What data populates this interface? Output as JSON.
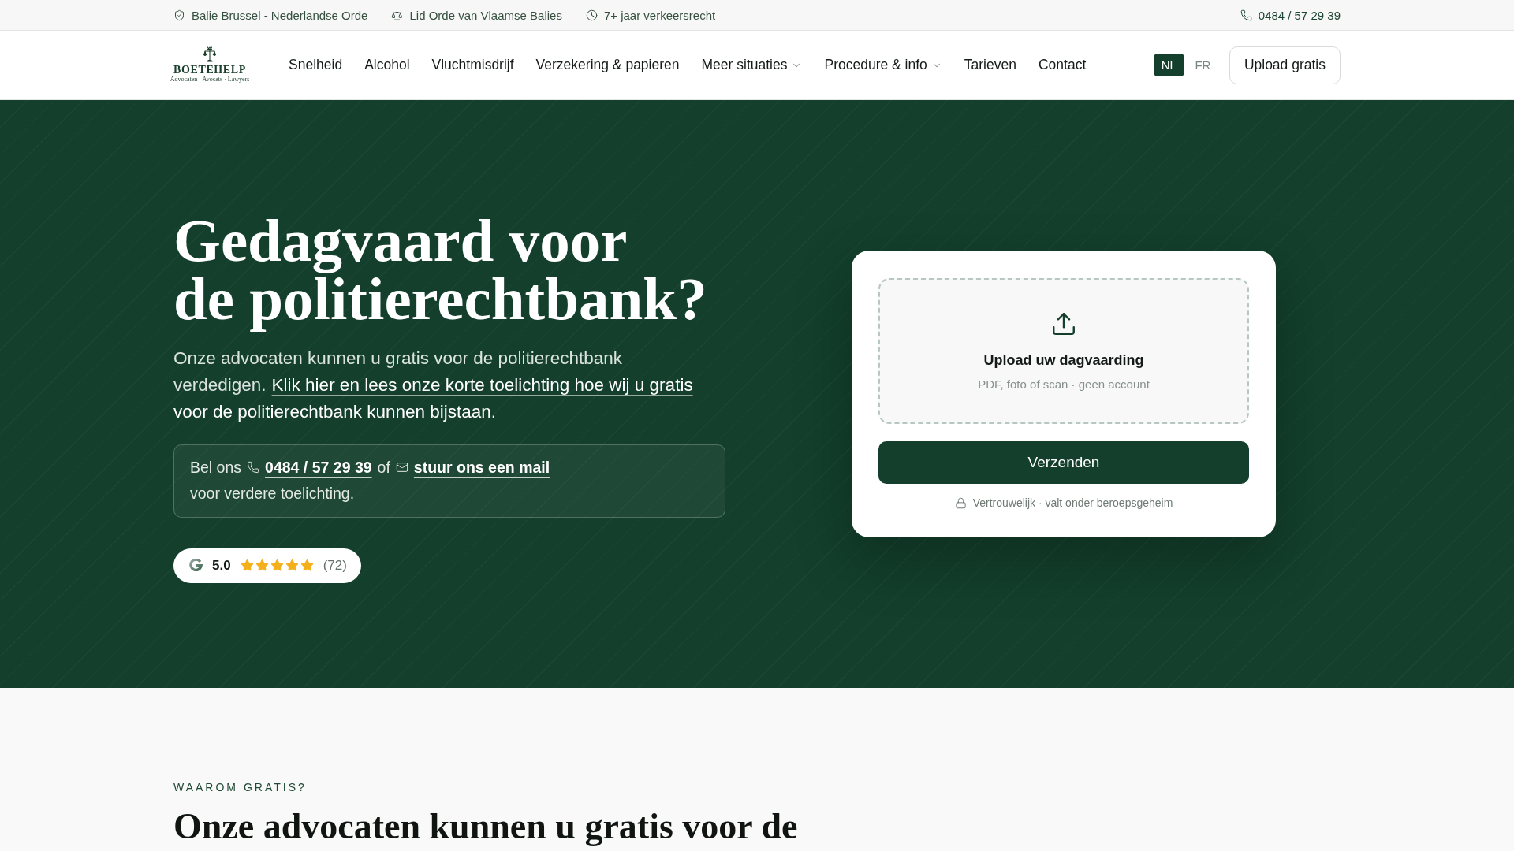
{
  "top_bar": {
    "items": [
      "Balie Brussel - Nederlandse Orde",
      "Lid Orde van Vlaamse Balies",
      "7+ jaar verkeersrecht"
    ],
    "phone": "0484 / 57 29 39"
  },
  "nav": {
    "logo": {
      "name": "BOETEHELP",
      "tagline": "Advocaten · Avocats · Lawyers"
    },
    "links": [
      {
        "label": "Snelheid",
        "kind": "link"
      },
      {
        "label": "Alcohol",
        "kind": "link"
      },
      {
        "label": "Vluchtmisdrijf",
        "kind": "link"
      },
      {
        "label": "Verzekering & papieren",
        "kind": "link"
      },
      {
        "label": "Meer situaties",
        "kind": "dropdown"
      },
      {
        "label": "Procedure & info",
        "kind": "dropdown"
      },
      {
        "label": "Tarieven",
        "kind": "link"
      },
      {
        "label": "Contact",
        "kind": "link"
      }
    ],
    "languages": [
      {
        "label": "NL",
        "selected": true
      },
      {
        "label": "FR",
        "selected": false
      }
    ],
    "cta": "Upload gratis"
  },
  "hero": {
    "title_lines": [
      "Gedagvaard voor",
      "de politierechtbank?"
    ],
    "intro": {
      "text_lines": [
        "Onze advocaten kunnen u gratis voor de politierechtbank",
        "verdedigen."
      ],
      "link_lines": [
        "Klik hier en lees onze korte toelichting hoe wij u gratis",
        "voor de politierechtbank kunnen bijstaan."
      ]
    },
    "contact": {
      "lead": "Bel ons",
      "phone": "0484 / 57 29 39",
      "connector": "of",
      "mail_link": "stuur ons een mail",
      "tail": "voor verdere toelichting."
    },
    "rating": {
      "score": "5.0",
      "stars": 5,
      "count": "(72)"
    }
  },
  "upload_card": {
    "dropzone": {
      "title": "Upload uw dagvaarding",
      "hint": "PDF, foto of scan · geen account"
    },
    "submit": "Verzenden",
    "note": "Vertrouwelijk · valt onder beroepsgeheim"
  },
  "section": {
    "eyebrow": "WAAROM GRATIS?",
    "heading": "Onze advocaten kunnen u gratis voor de"
  }
}
